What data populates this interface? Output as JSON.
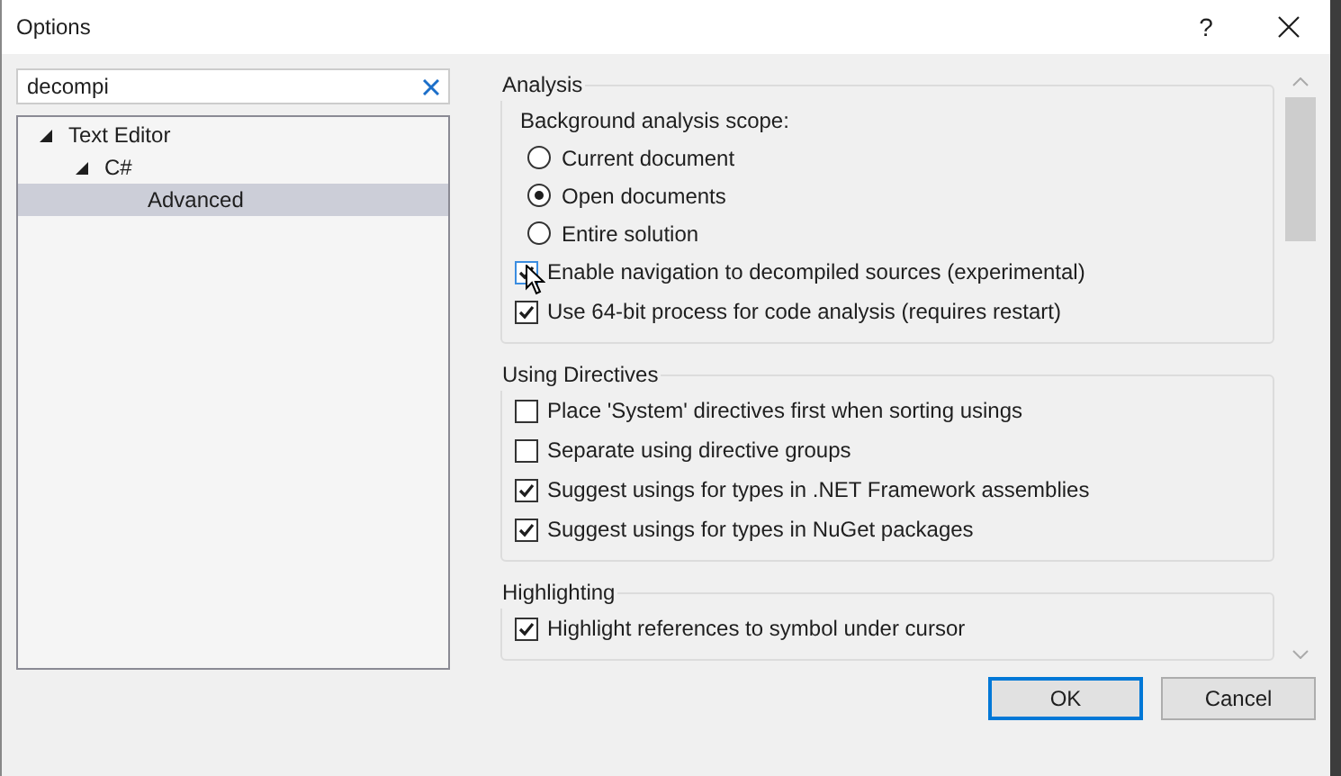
{
  "window": {
    "title": "Options",
    "help": "?"
  },
  "search": {
    "value": "decompi"
  },
  "tree": [
    {
      "label": "Text Editor",
      "expanded": true,
      "selected": false,
      "children": [
        {
          "label": "C#",
          "expanded": true,
          "selected": false,
          "children": [
            {
              "label": "Advanced",
              "selected": true
            }
          ]
        }
      ]
    }
  ],
  "groups": [
    {
      "title": "Analysis",
      "items": [
        {
          "kind": "label",
          "label": "Background analysis scope:"
        },
        {
          "kind": "radio",
          "label": "Current document",
          "selected": false
        },
        {
          "kind": "radio",
          "label": "Open documents",
          "selected": true
        },
        {
          "kind": "radio",
          "label": "Entire solution",
          "selected": false
        },
        {
          "kind": "checkbox",
          "label": "Enable navigation to decompiled sources (experimental)",
          "checked": true,
          "focused": true
        },
        {
          "kind": "checkbox",
          "label": "Use 64-bit process for code analysis (requires restart)",
          "checked": true,
          "focused": false
        }
      ]
    },
    {
      "title": "Using Directives",
      "items": [
        {
          "kind": "checkbox",
          "label": "Place 'System' directives first when sorting usings",
          "checked": false,
          "focused": false
        },
        {
          "kind": "checkbox",
          "label": "Separate using directive groups",
          "checked": false,
          "focused": false
        },
        {
          "kind": "checkbox",
          "label": "Suggest usings for types in .NET Framework assemblies",
          "checked": true,
          "focused": false
        },
        {
          "kind": "checkbox",
          "label": "Suggest usings for types in NuGet packages",
          "checked": true,
          "focused": false
        }
      ]
    },
    {
      "title": "Highlighting",
      "items": [
        {
          "kind": "checkbox",
          "label": "Highlight references to symbol under cursor",
          "checked": true,
          "focused": false
        }
      ]
    }
  ],
  "buttons": [
    {
      "label": "OK",
      "default": true
    },
    {
      "label": "Cancel",
      "default": false
    }
  ]
}
